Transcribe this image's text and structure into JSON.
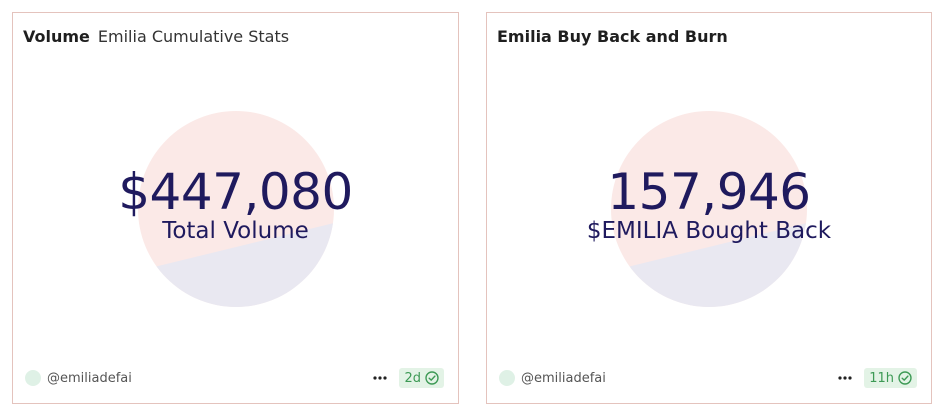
{
  "cards": [
    {
      "title": "Volume",
      "subtitle": "Emilia Cumulative Stats",
      "value": "$447,080",
      "label": "Total Volume",
      "author": "@emiliadefai",
      "age": "2d"
    },
    {
      "title": "Emilia Buy Back and Burn",
      "subtitle": "",
      "value": "157,946",
      "label": "$EMILIA Bought Back",
      "author": "@emiliadefai",
      "age": "11h"
    }
  ],
  "colors": {
    "card_border": "#e4c3bd",
    "value_text": "#1f1a5e",
    "logo_top": "#fbe9e7",
    "logo_bottom": "#e9e8f1",
    "badge_bg": "#e3f3e6",
    "badge_text": "#3d9a55"
  },
  "icons": {
    "more": "more-horizontal-icon",
    "status": "check-circle-icon"
  }
}
